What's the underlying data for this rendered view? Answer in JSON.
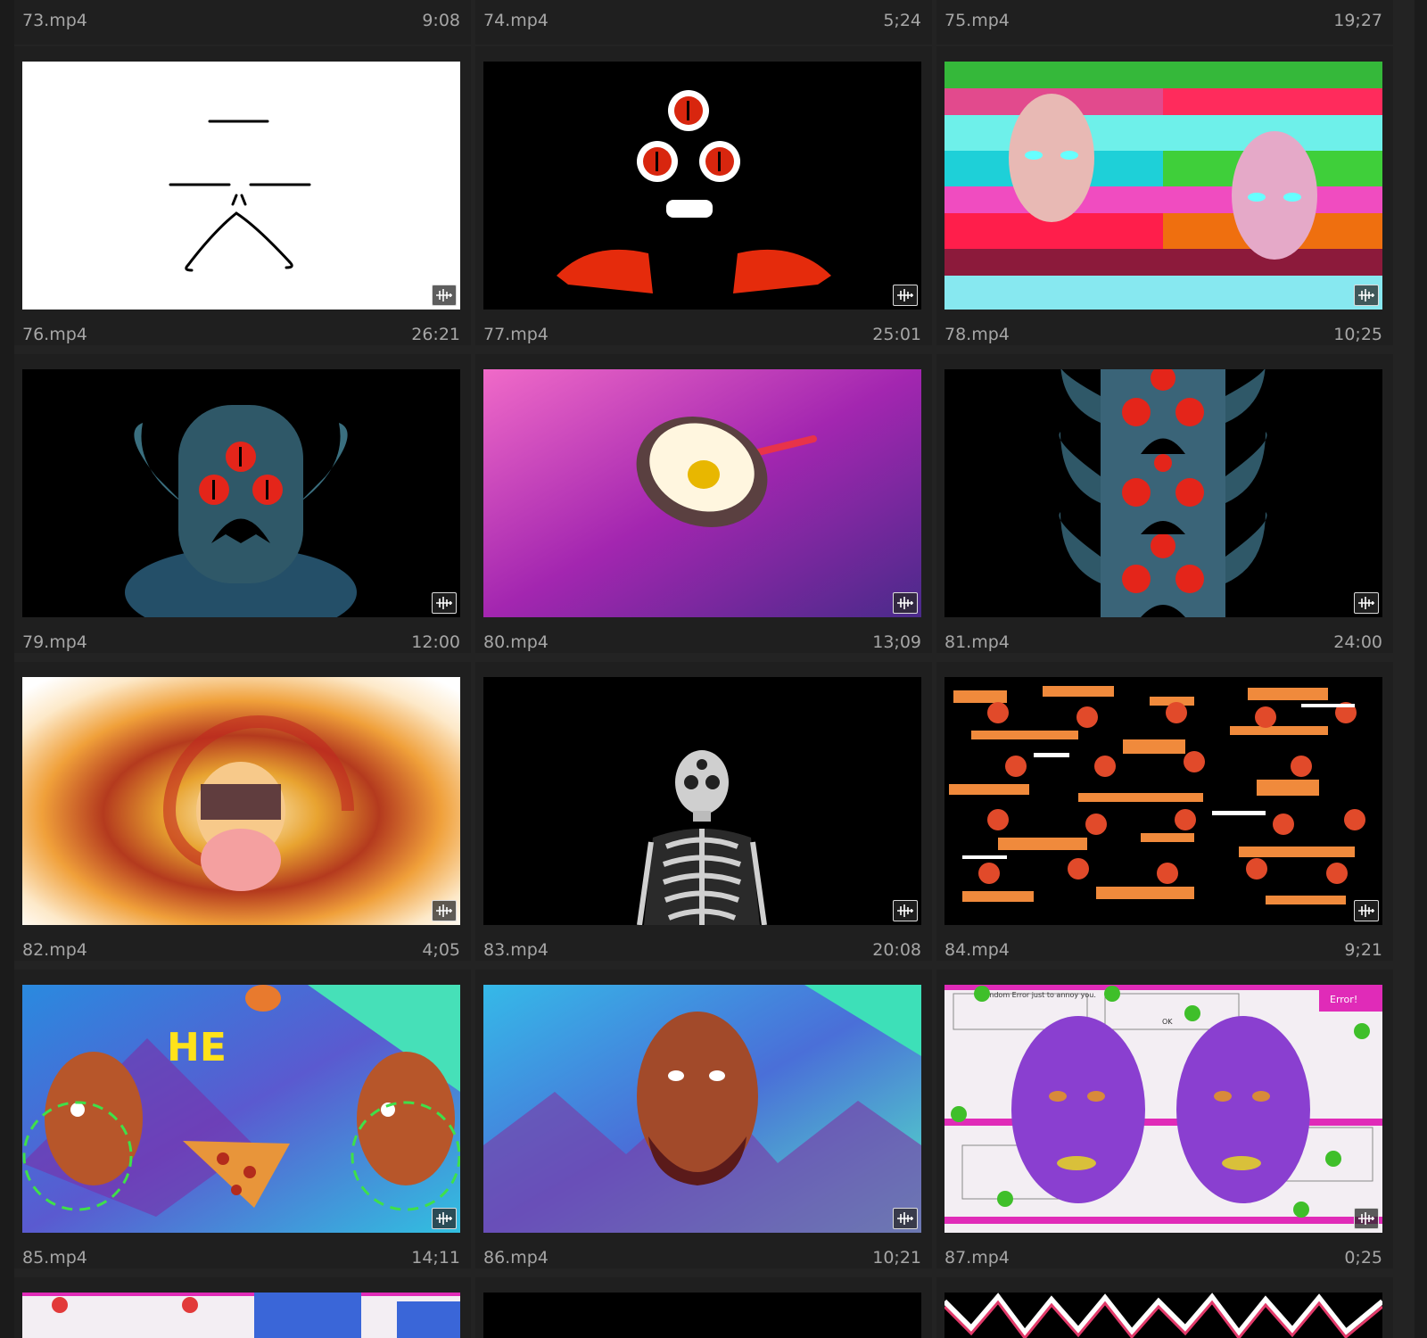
{
  "clips": [
    {
      "name": "73.mp4",
      "duration": "9:08"
    },
    {
      "name": "74.mp4",
      "duration": "5;24"
    },
    {
      "name": "75.mp4",
      "duration": "19;27"
    },
    {
      "name": "76.mp4",
      "duration": "26:21",
      "thumb": "white-face-drawing"
    },
    {
      "name": "77.mp4",
      "duration": "25:01",
      "thumb": "three-eyed-skull"
    },
    {
      "name": "78.mp4",
      "duration": "10;25",
      "thumb": "glitch-heads"
    },
    {
      "name": "79.mp4",
      "duration": "12:00",
      "thumb": "horned-monster"
    },
    {
      "name": "80.mp4",
      "duration": "13;09",
      "thumb": "frying-egg"
    },
    {
      "name": "81.mp4",
      "duration": "24:00",
      "thumb": "stacked-monsters"
    },
    {
      "name": "82.mp4",
      "duration": "4;05",
      "thumb": "spiral"
    },
    {
      "name": "83.mp4",
      "duration": "20:08",
      "thumb": "skeleton"
    },
    {
      "name": "84.mp4",
      "duration": "9;21",
      "thumb": "glitch-pattern"
    },
    {
      "name": "85.mp4",
      "duration": "14;11",
      "thumb": "heads-pizza"
    },
    {
      "name": "86.mp4",
      "duration": "10;21",
      "thumb": "head-waves"
    },
    {
      "name": "87.mp4",
      "duration": "0;25",
      "thumb": "purple-faces-errors"
    }
  ],
  "overlay_text": {
    "clip85_text": "HE",
    "error_dialog_title": "Error!",
    "error_dialog_message": "Random Error just to annoy you.",
    "error_dialog_ok": "OK"
  },
  "icons": {
    "badge": "audio-waveform-icon"
  }
}
